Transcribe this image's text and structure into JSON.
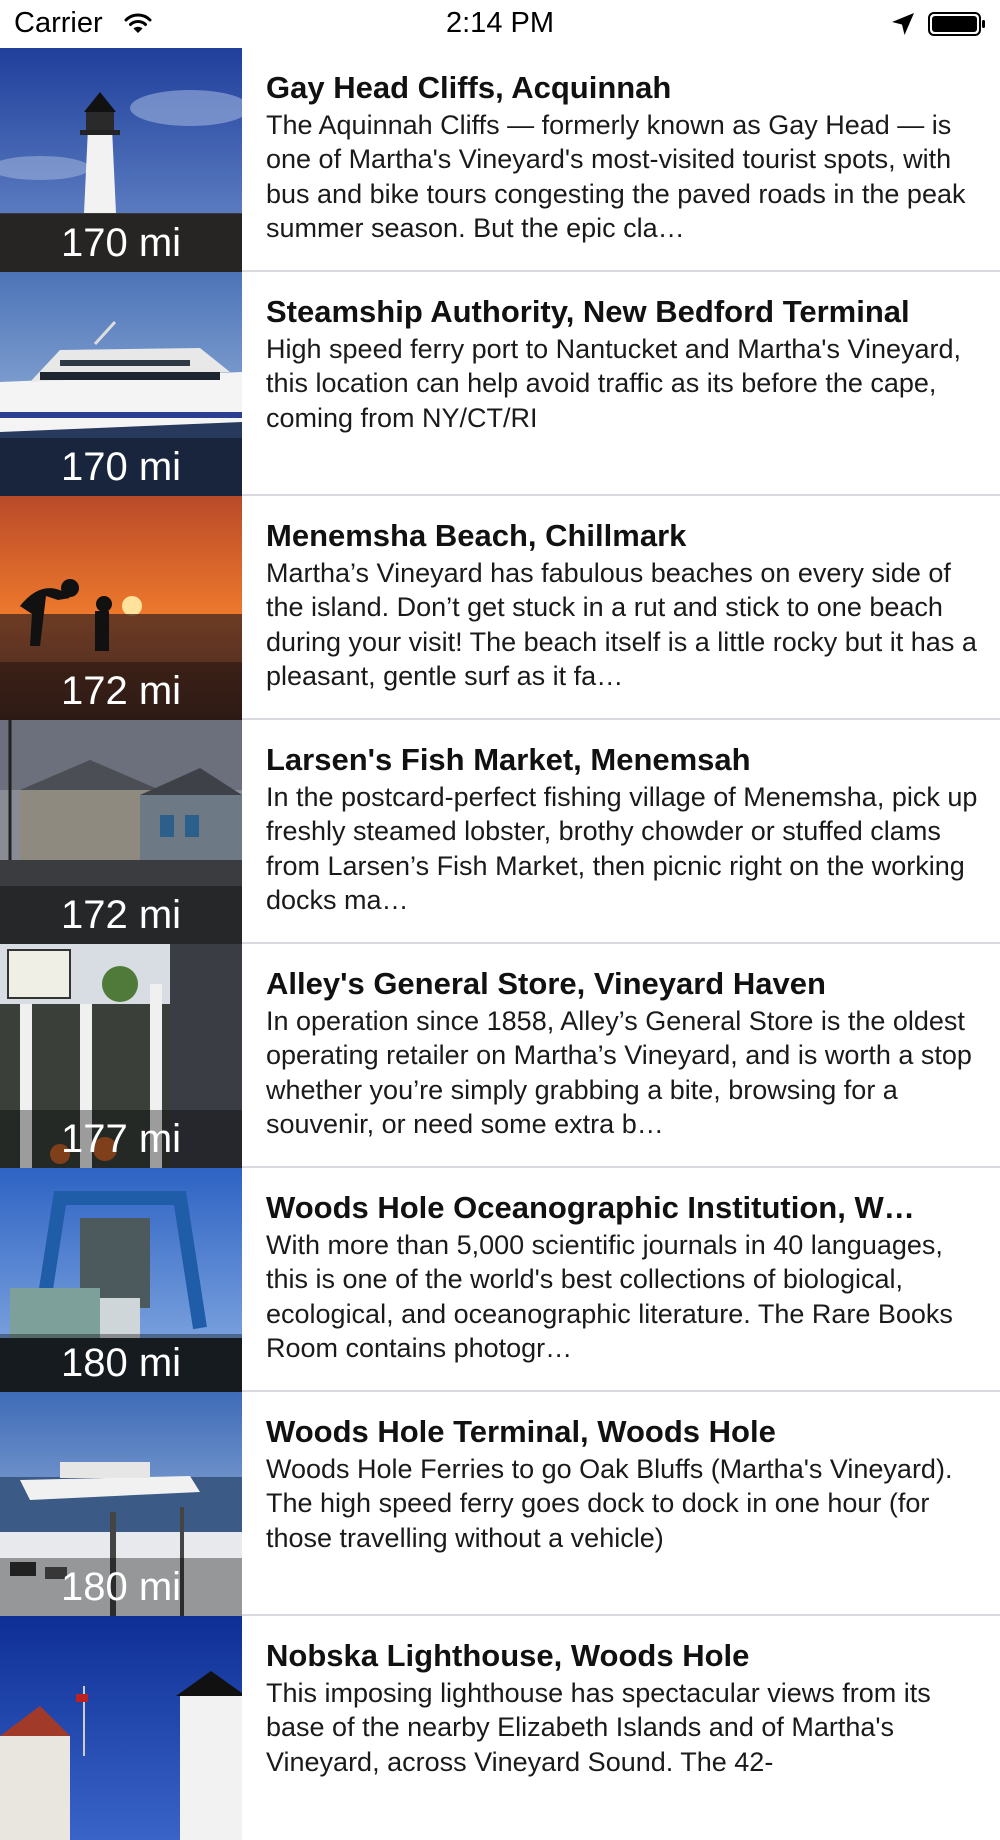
{
  "status_bar": {
    "carrier": "Carrier",
    "time": "2:14 PM"
  },
  "places": [
    {
      "title": "Gay Head Cliffs, Acquinnah",
      "distance": "170 mi",
      "description": "The Aquinnah Cliffs — formerly known as Gay Head — is one of Martha's Vineyard's most-visited tourist spots, with bus and bike tours congesting the paved roads in the peak summer season. But the epic cla…"
    },
    {
      "title": "Steamship Authority, New Bedford Terminal",
      "distance": "170 mi",
      "description": "High speed ferry port to Nantucket and Martha's Vineyard, this location can help avoid traffic as its before the cape, coming from NY/CT/RI"
    },
    {
      "title": "Menemsha Beach, Chillmark",
      "distance": "172 mi",
      "description": "Martha’s Vineyard has fabulous beaches on every side of the island. Don’t get stuck in a rut and stick to one beach during your visit! The beach itself is a little rocky but it has a pleasant, gentle surf as it fa…"
    },
    {
      "title": "Larsen's Fish Market, Menemsah",
      "distance": "172 mi",
      "description": "In the postcard-perfect fishing village of Menemsha, pick up freshly steamed lobster, brothy chowder or stuffed clams from Larsen’s Fish Market, then picnic right on the working docks ma…"
    },
    {
      "title": "Alley's General Store, Vineyard Haven",
      "distance": "177 mi",
      "description": "In operation since 1858, Alley’s General Store is the oldest operating retailer on Martha’s Vineyard, and is worth a stop whether you’re simply grabbing a bite, browsing for a souvenir, or need some extra b…"
    },
    {
      "title": "Woods Hole Oceanographic Institution, W…",
      "distance": "180 mi",
      "description": "With more than 5,000 scientific journals in 40 languages, this is one of the world's best collections of biological, ecological, and oceanographic literature. The Rare Books Room contains photogr…"
    },
    {
      "title": "Woods Hole Terminal, Woods Hole",
      "distance": "180 mi",
      "description": "Woods Hole Ferries to go Oak Bluffs (Martha's Vineyard). The high speed ferry goes dock to dock in one hour (for those travelling without a vehicle)"
    },
    {
      "title": "Nobska Lighthouse, Woods Hole",
      "distance": "",
      "description": "This imposing lighthouse has spectacular views from its base of the nearby Elizabeth Islands and of Martha's Vineyard, across Vineyard Sound. The 42-"
    }
  ]
}
